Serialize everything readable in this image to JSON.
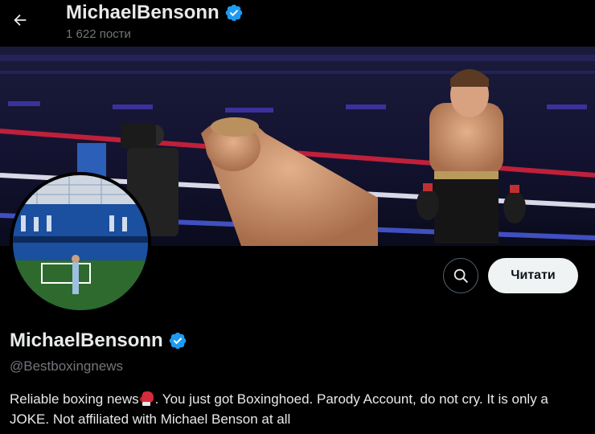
{
  "header": {
    "name": "MichaelBensonn",
    "post_count": "1 622 пости",
    "back_icon": "arrow-left-icon"
  },
  "profile": {
    "display_name": "MichaelBensonn",
    "handle": "@Bestboxingnews",
    "verified_icon": "verified-badge-icon",
    "bio_part1": "Reliable boxing news",
    "bio_emoji": "boxing-glove-icon",
    "bio_part2": ". You just got Boxinghoed. Parody Account, do not cry. It is only a JOKE. Not affiliated with Michael Benson at all"
  },
  "actions": {
    "search_icon": "search-icon",
    "follow_label": "Читати"
  },
  "colors": {
    "verified": "#1d9bf0",
    "background": "#000000",
    "secondary_text": "#71767b",
    "follow_bg": "#eff3f4"
  }
}
